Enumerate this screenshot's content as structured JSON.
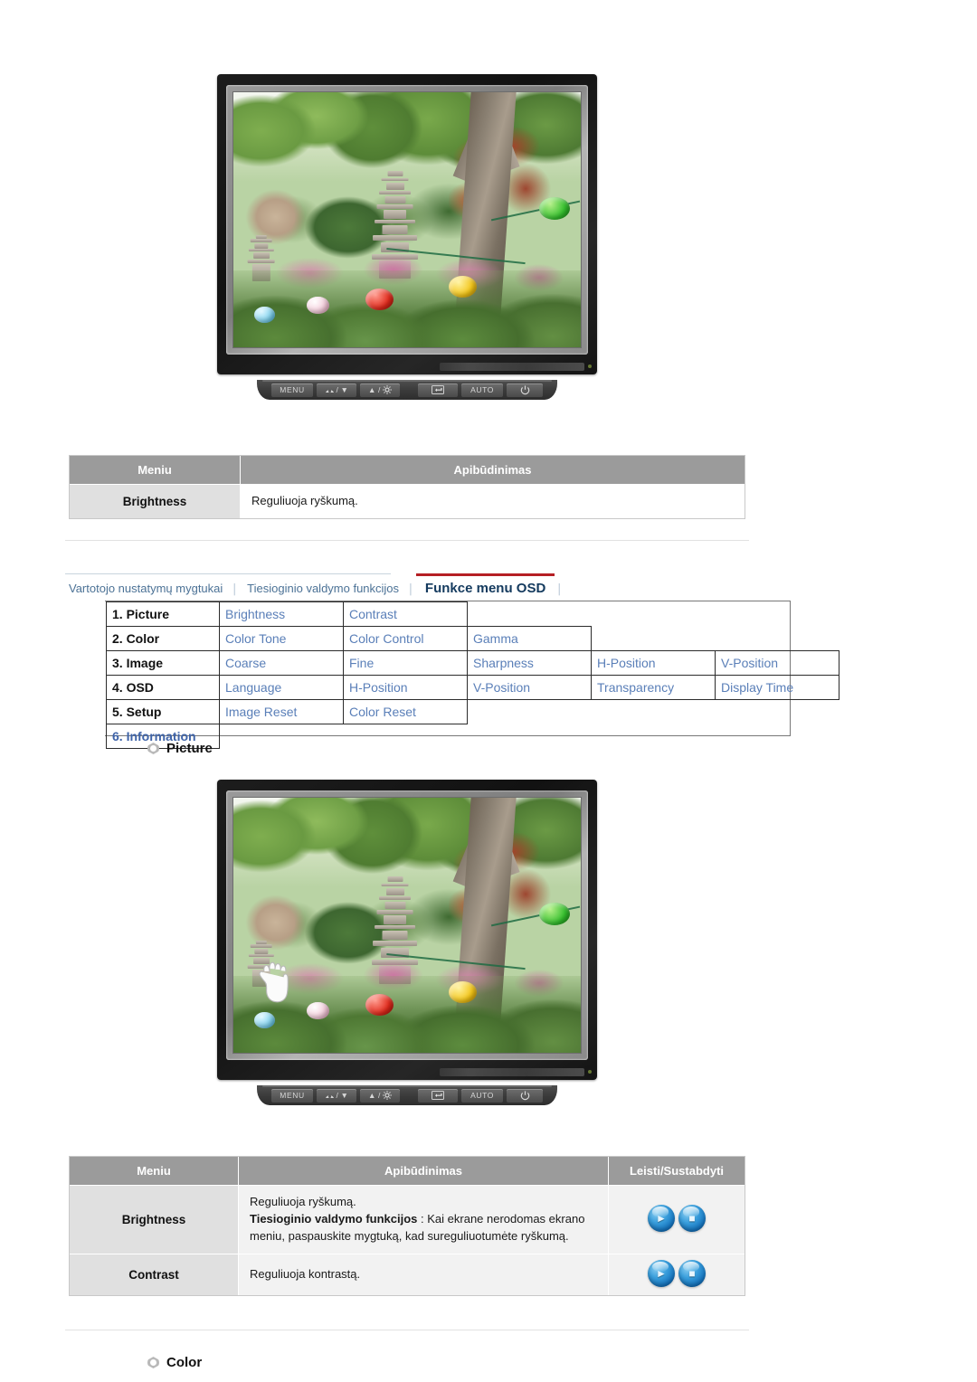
{
  "page": {
    "language": "lt"
  },
  "monitor_top": {
    "name": "lcd-monitor-illustration",
    "screen_scene": "garden with stone pagoda, trees and paper lanterns",
    "buttons": [
      {
        "id": "menu",
        "label": "MENU"
      },
      {
        "id": "down",
        "label": "▼"
      },
      {
        "id": "up",
        "label": "▲"
      },
      {
        "id": "enter",
        "label": "↵"
      },
      {
        "id": "auto",
        "label": "AUTO"
      },
      {
        "id": "power",
        "label": "⏻"
      }
    ]
  },
  "table_brightness": {
    "headers": [
      "Meniu",
      "Apibūdinimas"
    ],
    "rows": [
      {
        "menu": "Brightness",
        "description": "Reguliuoja ryškumą."
      }
    ]
  },
  "nav": {
    "links": [
      {
        "label": "Vartotojo nustatymų mygtukai",
        "active": false
      },
      {
        "label": "Tiesioginio valdymo funkcijos",
        "active": false
      },
      {
        "label": "Funkce menu OSD",
        "active": true
      }
    ],
    "separator": "│",
    "accent_color": "#b51f24",
    "link_color": "#4c7296",
    "active_color": "#143a5e"
  },
  "osd_map": {
    "rows": [
      {
        "category": "1. Picture",
        "items": [
          "Brightness",
          "Contrast"
        ]
      },
      {
        "category": "2. Color",
        "items": [
          "Color Tone",
          "Color Control",
          "Gamma"
        ]
      },
      {
        "category": "3. Image",
        "items": [
          "Coarse",
          "Fine",
          "Sharpness",
          "H-Position",
          "V-Position"
        ]
      },
      {
        "category": "4. OSD",
        "items": [
          "Language",
          "H-Position",
          "V-Position",
          "Transparency",
          "Display Time"
        ]
      },
      {
        "category": "5. Setup",
        "items": [
          "Image Reset",
          "Color Reset"
        ]
      },
      {
        "category": "6. Information",
        "items": []
      }
    ],
    "category_color": "#111111",
    "item_color": "#5a7fb8",
    "information_color": "#3e63a8"
  },
  "section_picture": {
    "label": "Picture",
    "bullet": "diamond-circle-icon"
  },
  "monitor_bottom": {
    "name": "lcd-monitor-illustration-with-hand",
    "cursor": "hand-pressing-menu-button",
    "buttons": [
      {
        "id": "menu",
        "label": "MENU"
      },
      {
        "id": "down",
        "label": "▼"
      },
      {
        "id": "up",
        "label": "▲"
      },
      {
        "id": "enter",
        "label": "↵"
      },
      {
        "id": "auto",
        "label": "AUTO"
      },
      {
        "id": "power",
        "label": "⏻"
      }
    ]
  },
  "table_picture": {
    "headers": [
      "Meniu",
      "Apibūdinimas",
      "Leisti/Sustabdyti"
    ],
    "rows": [
      {
        "menu": "Brightness",
        "desc_line1": "Reguliuoja ryškumą.",
        "desc_bold": "Tiesioginio valdymo funkcijos",
        "desc_rest": " : Kai ekrane nerodomas ekrano meniu, paspauskite mygtuką, kad sureguliuotumėte ryškumą.",
        "controls": [
          "play-icon",
          "stop-icon"
        ]
      },
      {
        "menu": "Contrast",
        "desc_line1": "Reguliuoja kontrastą.",
        "desc_bold": "",
        "desc_rest": "",
        "controls": [
          "play-icon",
          "stop-icon"
        ]
      }
    ]
  },
  "section_color": {
    "label": "Color",
    "bullet": "diamond-circle-icon"
  },
  "colors": {
    "header_grey": "#9b9b9b",
    "menu_cell_grey": "#e0e0e0",
    "desc_cell_grey": "#f2f2f2",
    "rule_grey": "#e2e2e2",
    "button_blue": "#1574bf"
  }
}
